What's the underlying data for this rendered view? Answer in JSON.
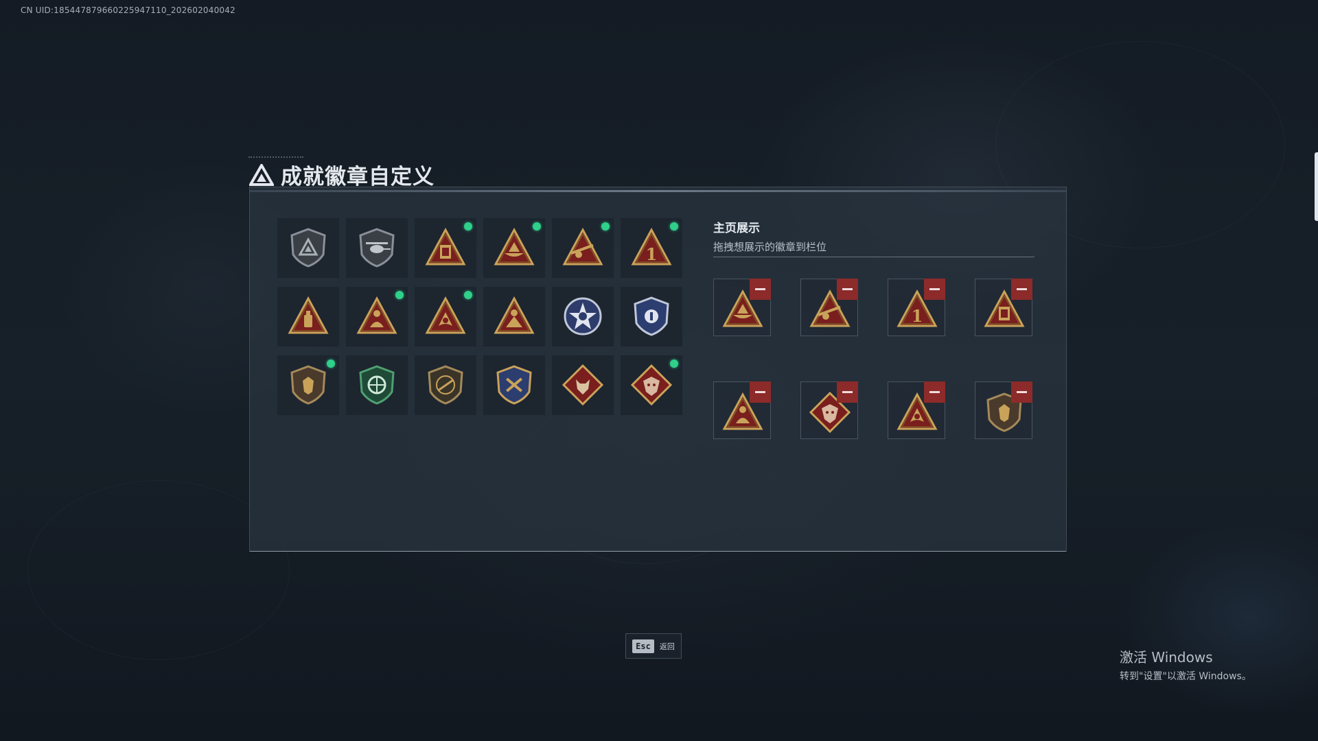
{
  "uid_text": "CN UID:1854478796602259471​10_202602040042",
  "title": "成就徽章自定义",
  "showcase": {
    "title": "主页展示",
    "subtitle": "拖拽想展示的徽章到栏位"
  },
  "badges": [
    {
      "icon": "triangle-shield-badge-icon",
      "new": false
    },
    {
      "icon": "helicopter-shield-badge-icon",
      "new": false
    },
    {
      "icon": "supply-crate-badge-icon",
      "new": true
    },
    {
      "icon": "boat-badge-icon",
      "new": true
    },
    {
      "icon": "sniper-badge-icon",
      "new": true
    },
    {
      "icon": "number-one-badge-icon",
      "new": true
    },
    {
      "icon": "bottle-badge-icon",
      "new": false
    },
    {
      "icon": "medic-badge-icon",
      "new": true
    },
    {
      "icon": "lion-badge-icon",
      "new": true
    },
    {
      "icon": "soldier-badge-icon",
      "new": false
    },
    {
      "icon": "star-skull-badge-icon",
      "new": false
    },
    {
      "icon": "police-badge-icon",
      "new": false
    },
    {
      "icon": "lion-shield-badge-icon",
      "new": true
    },
    {
      "icon": "green-crosshair-badge-icon",
      "new": false
    },
    {
      "icon": "rifle-shield-badge-icon",
      "new": false
    },
    {
      "icon": "crossed-hammers-badge-icon",
      "new": false
    },
    {
      "icon": "wolf-diamond-badge-icon",
      "new": false
    },
    {
      "icon": "dragon-diamond-badge-icon",
      "new": true
    }
  ],
  "showcase_slots": [
    {
      "icon": "boat-badge-icon"
    },
    {
      "icon": "sniper-badge-icon"
    },
    {
      "icon": "number-one-badge-icon"
    },
    {
      "icon": "supply-crate-badge-icon"
    },
    {
      "icon": "medic-badge-icon"
    },
    {
      "icon": "dragon-diamond-badge-icon"
    },
    {
      "icon": "lion-badge-icon"
    },
    {
      "icon": "lion-shield-badge-icon"
    }
  ],
  "esc": {
    "key": "Esc",
    "label": "返回"
  },
  "windows_activation": {
    "line1": "激活 Windows",
    "line2": "转到\"设置\"以激活 Windows。"
  }
}
